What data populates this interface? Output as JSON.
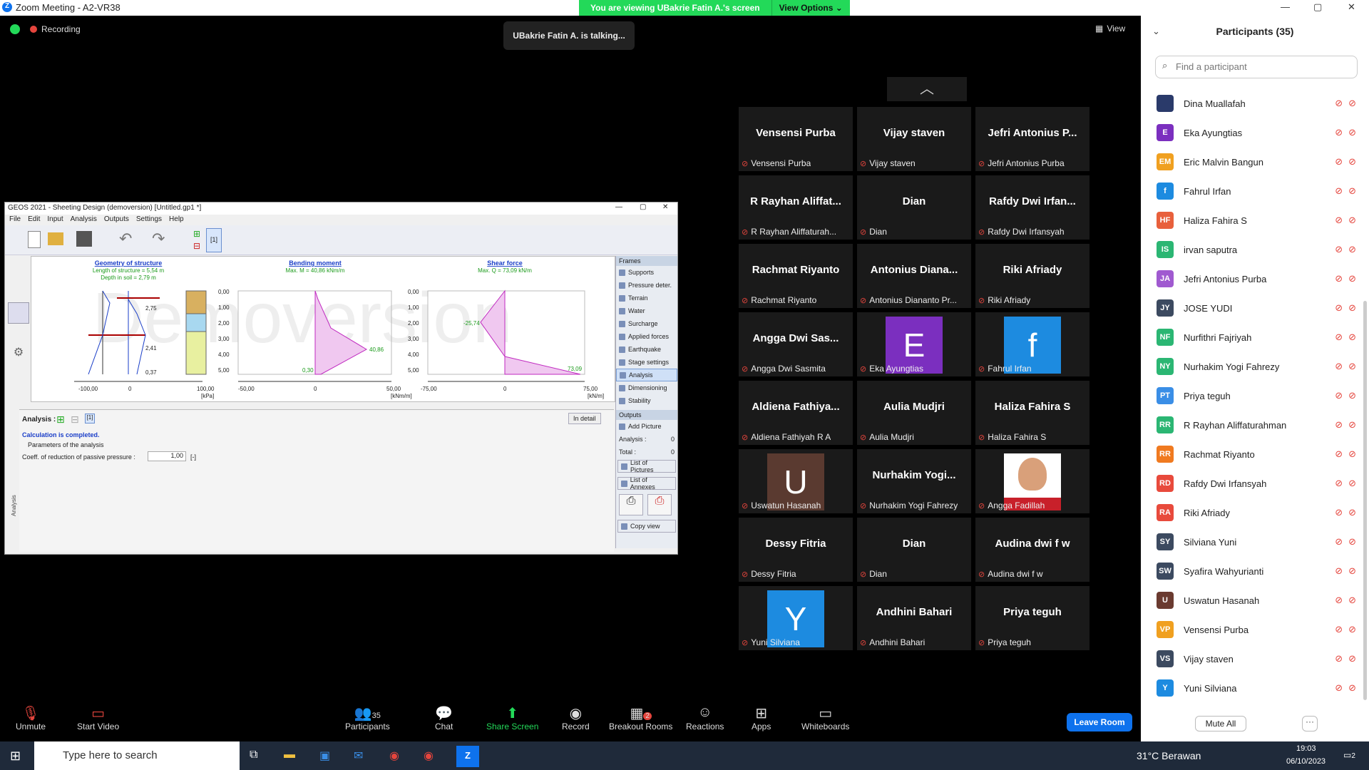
{
  "window": {
    "title": "Zoom Meeting - A2-VR38",
    "minimize": "—",
    "maximize": "▢",
    "close": "✕"
  },
  "banner": {
    "viewing": "You are viewing UBakrie Fatin A.'s screen",
    "view_options": "View Options"
  },
  "recording": "Recording",
  "talking": "UBakrie Fatin A. is talking...",
  "view_label": "View",
  "geos": {
    "title": "GEOS 2021 - Sheeting Design (demoversion) [Untitled.gp1 *]",
    "menu": [
      "File",
      "Edit",
      "Input",
      "Analysis",
      "Outputs",
      "Settings",
      "Help"
    ],
    "chart1": {
      "title": "Geometry of structure",
      "l1": "Length of structure = 5,54 m",
      "l2": "Depth in soil = 2,79 m",
      "unit": "[kPa]",
      "ticks": [
        "-100,00",
        "0",
        "100,00"
      ],
      "labels": [
        "2,75",
        "2,41",
        "0,37"
      ]
    },
    "chart2": {
      "title": "Bending moment",
      "l1": "Max. M = 40,86 kNm/m",
      "unit": "[kNm/m]",
      "ticks": [
        "-50,00",
        "0",
        "50,00"
      ],
      "labels": [
        "40,86",
        "0,30"
      ]
    },
    "chart3": {
      "title": "Shear force",
      "l1": "Max. Q = 73,09 kN/m",
      "unit": "[kN/m]",
      "ticks": [
        "-75,00",
        "0",
        "75,00"
      ],
      "labels": [
        "-25,74",
        "73,09"
      ]
    },
    "yticks": [
      "0,00",
      "1,00",
      "2,00",
      "3,00",
      "4,00",
      "5,00"
    ],
    "watermark": "Demoversion",
    "frames_title": "Frames",
    "frames": [
      "Supports",
      "Pressure deter.",
      "Terrain",
      "Water",
      "Surcharge",
      "Applied forces",
      "Earthquake",
      "Stage settings",
      "Analysis",
      "Dimensioning",
      "Stability"
    ],
    "outputs_title": "Outputs",
    "add_picture": "Add Picture",
    "analysis_label": "Analysis :",
    "analysis_count": "0",
    "total_label": "Total :",
    "total_count": "0",
    "list_pictures": "List of Pictures",
    "list_annexes": "List of Annexes",
    "copy_view": "Copy view",
    "panel_title": "Analysis :",
    "stage_label": "[1]",
    "in_detail": "In detail",
    "calc_done": "Calculation is completed.",
    "params": "Parameters of the analysis",
    "coeff_label": "Coeff. of reduction of passive pressure :",
    "coeff_value": "1,00",
    "coeff_unit": "[-]",
    "side_tab": "Analysis"
  },
  "tiles": [
    {
      "name": "Vensensi Purba",
      "label": "Vensensi Purba"
    },
    {
      "name": "Vijay staven",
      "label": "Vijay staven"
    },
    {
      "name": "Jefri Antonius P...",
      "label": "Jefri Antonius Purba"
    },
    {
      "name": "R Rayhan Aliffat...",
      "label": "R Rayhan Aliffaturah..."
    },
    {
      "name": "Dian",
      "label": "Dian"
    },
    {
      "name": "Rafdy Dwi Irfan...",
      "label": "Rafdy Dwi Irfansyah"
    },
    {
      "name": "Rachmat Riyanto",
      "label": "Rachmat Riyanto"
    },
    {
      "name": "Antonius Diana...",
      "label": "Antonius Diananto Pr..."
    },
    {
      "name": "Riki Afriady",
      "label": "Riki Afriady"
    },
    {
      "name": "Angga Dwi Sas...",
      "label": "Angga Dwi Sasmita"
    },
    {
      "avatar": "E",
      "color": "#7b2fbf",
      "label": "Eka Ayungtias"
    },
    {
      "avatar": "f",
      "color": "#1d8be0",
      "label": "Fahrul Irfan"
    },
    {
      "name": "Aldiena Fathiya...",
      "label": "Aldiena Fathiyah R A"
    },
    {
      "name": "Aulia Mudjri",
      "label": "Aulia Mudjri"
    },
    {
      "name": "Haliza Fahira S",
      "label": "Haliza Fahira S"
    },
    {
      "avatar": "U",
      "color": "#5a3a30",
      "label": "Uswatun Hasanah"
    },
    {
      "name": "Nurhakim Yogi...",
      "label": "Nurhakim Yogi Fahrezy"
    },
    {
      "avatar": "",
      "color": "#c8202a",
      "label": "Angga Fadillah",
      "photo": true
    },
    {
      "name": "Dessy Fitria",
      "label": "Dessy Fitria"
    },
    {
      "name": "Dian",
      "label": "Dian"
    },
    {
      "name": "Audina dwi f w",
      "label": "Audina dwi f w"
    },
    {
      "avatar": "Y",
      "color": "#1d8be0",
      "label": "Yuni Silviana"
    },
    {
      "name": "Andhini Bahari",
      "label": "Andhini Bahari"
    },
    {
      "name": "Priya teguh",
      "label": "Priya teguh"
    }
  ],
  "participants": {
    "title": "Participants (35)",
    "search_placeholder": "Find a participant",
    "list": [
      {
        "initials": "",
        "name": "Dina Muallafah",
        "color": "#2a3a6a"
      },
      {
        "initials": "E",
        "name": "Eka Ayungtias",
        "color": "#7b2fbf"
      },
      {
        "initials": "EM",
        "name": "Eric Malvin Bangun",
        "color": "#f0a020"
      },
      {
        "initials": "f",
        "name": "Fahrul Irfan",
        "color": "#1d8be0"
      },
      {
        "initials": "HF",
        "name": "Haliza Fahira S",
        "color": "#e8603c"
      },
      {
        "initials": "IS",
        "name": "irvan saputra",
        "color": "#2bb673"
      },
      {
        "initials": "JA",
        "name": "Jefri Antonius Purba",
        "color": "#a05ad0"
      },
      {
        "initials": "JY",
        "name": "JOSE YUDI",
        "color": "#3c4a60"
      },
      {
        "initials": "NF",
        "name": "Nurfithri Fajriyah",
        "color": "#2bb673"
      },
      {
        "initials": "NY",
        "name": "Nurhakim Yogi Fahrezy",
        "color": "#2bb673"
      },
      {
        "initials": "PT",
        "name": "Priya teguh",
        "color": "#3a8ee6"
      },
      {
        "initials": "RR",
        "name": "R Rayhan Aliffaturahman",
        "color": "#2bb673"
      },
      {
        "initials": "RR",
        "name": "Rachmat Riyanto",
        "color": "#f07a20"
      },
      {
        "initials": "RD",
        "name": "Rafdy Dwi Irfansyah",
        "color": "#e84a3c"
      },
      {
        "initials": "RA",
        "name": "Riki Afriady",
        "color": "#e84a3c"
      },
      {
        "initials": "SY",
        "name": "Silviana Yuni",
        "color": "#3c4a60"
      },
      {
        "initials": "SW",
        "name": "Syafira Wahyurianti",
        "color": "#3c4a60"
      },
      {
        "initials": "U",
        "name": "Uswatun Hasanah",
        "color": "#6a3a30"
      },
      {
        "initials": "VP",
        "name": "Vensensi Purba",
        "color": "#f0a020"
      },
      {
        "initials": "VS",
        "name": "Vijay staven",
        "color": "#3c4a60"
      },
      {
        "initials": "Y",
        "name": "Yuni Silviana",
        "color": "#1d8be0"
      }
    ],
    "mute_all": "Mute All",
    "more": "···"
  },
  "toolbar": {
    "unmute": "Unmute",
    "start_video": "Start Video",
    "participants": "Participants",
    "participants_count": "35",
    "chat": "Chat",
    "share": "Share Screen",
    "record": "Record",
    "breakout": "Breakout Rooms",
    "breakout_badge": "2",
    "reactions": "Reactions",
    "apps": "Apps",
    "whiteboards": "Whiteboards",
    "leave": "Leave Room"
  },
  "taskbar": {
    "search": "Type here to search",
    "weather": "31°C Berawan",
    "time": "19:03",
    "date": "06/10/2023",
    "notif": "2"
  }
}
